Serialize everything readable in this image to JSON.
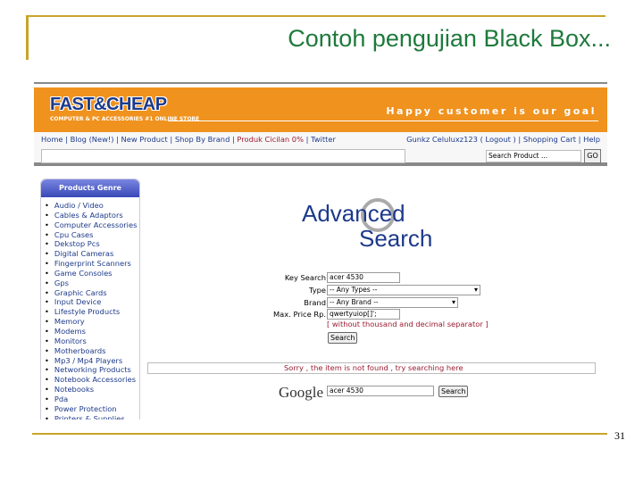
{
  "slide": {
    "title": "Contoh pengujian Black Box...",
    "page_number": "31"
  },
  "site": {
    "logo": "FAST&CHEAP",
    "logo_sub": "COMPUTER & PC ACCESSORIES #1 ONLINE STORE",
    "slogan": "Happy customer is our goal",
    "nav_left": [
      "Home",
      "Blog (New!)",
      "New Product",
      "Shop By Brand",
      "Produk Cicilan 0%",
      "Twitter"
    ],
    "nav_right": [
      "Gunkz Celuluxz123",
      "( Logout )",
      "Shopping Cart",
      "Help"
    ],
    "search_placeholder": "Search Product ...",
    "go_label": "GO",
    "sidebar": {
      "title": "Products Genre",
      "items": [
        "Audio / Video",
        "Cables & Adaptors",
        "Computer Accessories",
        "Cpu Cases",
        "Dekstop Pcs",
        "Digital Cameras",
        "Fingerprint Scanners",
        "Game Consoles",
        "Gps",
        "Graphic Cards",
        "Input Device",
        "Lifestyle Products",
        "Memory",
        "Modems",
        "Monitors",
        "Motherboards",
        "Mp3 / Mp4 Players",
        "Networking Products",
        "Notebook Accessories",
        "Notebooks",
        "Pda",
        "Power Protection",
        "Printers & Supplies"
      ]
    },
    "advanced_search": {
      "logo_line1": "Advanced",
      "logo_line2": "Search",
      "key_label": "Key Search",
      "key_value": "acer 4530",
      "type_label": "Type",
      "type_value": "-- Any Types --",
      "brand_label": "Brand",
      "brand_value": "-- Any Brand --",
      "price_label": "Max. Price Rp.",
      "price_value": "qwertyuiop[]';",
      "note": "[ without thousand and decimal separator ]",
      "search_label": "Search"
    },
    "result_message": "Sorry , the item is not found , try searching here",
    "google": {
      "logo": "Google",
      "value": "acer 4530",
      "search_label": "Search"
    }
  }
}
